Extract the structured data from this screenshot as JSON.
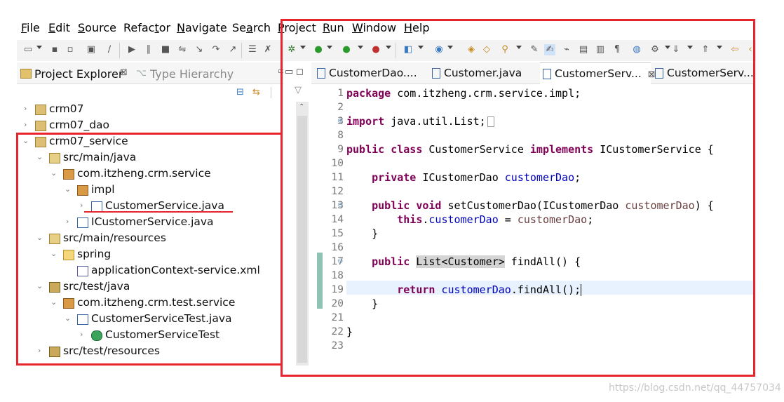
{
  "menu": [
    "File",
    "Edit",
    "Source",
    "Refactor",
    "Navigate",
    "Search",
    "Project",
    "Run",
    "Window",
    "Help"
  ],
  "menu_mnemonics": [
    "F",
    "E",
    "S",
    "t",
    "N",
    "a",
    "P",
    "R",
    "W",
    "H"
  ],
  "explorer": {
    "tab_active": "Project Explorer",
    "tab_inactive": "Type Hierarchy",
    "tree": [
      {
        "label": "crm07",
        "level": 0,
        "expanded": false,
        "icon": "project-icon"
      },
      {
        "label": "crm07_dao",
        "level": 0,
        "expanded": false,
        "icon": "project-icon"
      },
      {
        "label": "crm07_service",
        "level": 0,
        "expanded": true,
        "icon": "project-icon"
      },
      {
        "label": "src/main/java",
        "level": 1,
        "expanded": true,
        "icon": "source-folder-icon"
      },
      {
        "label": "com.itzheng.crm.service",
        "level": 2,
        "expanded": true,
        "icon": "package-icon"
      },
      {
        "label": "impl",
        "level": 3,
        "expanded": true,
        "icon": "package-icon"
      },
      {
        "label": "CustomerService.java",
        "level": 4,
        "expanded": false,
        "icon": "java-file-icon"
      },
      {
        "label": "ICustomerService.java",
        "level": 3,
        "expanded": false,
        "icon": "java-interface-icon"
      },
      {
        "label": "src/main/resources",
        "level": 1,
        "expanded": true,
        "icon": "source-folder-icon"
      },
      {
        "label": "spring",
        "level": 2,
        "expanded": true,
        "icon": "folder-icon"
      },
      {
        "label": "applicationContext-service.xml",
        "level": 3,
        "expanded": null,
        "icon": "xml-file-icon"
      },
      {
        "label": "src/test/java",
        "level": 1,
        "expanded": true,
        "icon": "source-folder-icon"
      },
      {
        "label": "com.itzheng.crm.test.service",
        "level": 2,
        "expanded": true,
        "icon": "package-icon"
      },
      {
        "label": "CustomerServiceTest.java",
        "level": 3,
        "expanded": true,
        "icon": "java-file-icon"
      },
      {
        "label": "CustomerServiceTest",
        "level": 4,
        "expanded": false,
        "icon": "class-icon"
      },
      {
        "label": "src/test/resources",
        "level": 1,
        "expanded": false,
        "icon": "source-folder-icon"
      }
    ]
  },
  "editor": {
    "tabs": [
      {
        "label": "CustomerDao....",
        "active": false
      },
      {
        "label": "Customer.java",
        "active": false
      },
      {
        "label": "CustomerServ...",
        "active": true
      },
      {
        "label": "CustomerServ...",
        "active": false
      }
    ],
    "line_numbers": [
      "1",
      "2",
      "3",
      "8",
      "9",
      "10",
      "11",
      "12",
      "13",
      "14",
      "15",
      "16",
      "17",
      "18",
      "19",
      "20",
      "21",
      "22",
      "23"
    ],
    "code": {
      "l1_kw": "package",
      "l1_rest": " com.itzheng.crm.service.impl;",
      "l3_kw": "import",
      "l3_rest": " java.util.List;",
      "l9_kw1": "public",
      "l9_kw2": "class",
      "l9_mid": " CustomerService ",
      "l9_kw3": "implements",
      "l9_rest": " ICustomerService {",
      "l11_kw": "private",
      "l11_type": " ICustomerDao ",
      "l11_fld": "customerDao",
      "l11_end": ";",
      "l13_kw1": "public",
      "l13_kw2": "void",
      "l13_mid": " setCustomerDao(ICustomerDao ",
      "l13_param": "customerDao",
      "l13_end": ") {",
      "l14_kw": "this",
      "l14_dot": ".",
      "l14_fld": "customerDao",
      "l14_eq": " = ",
      "l14_param": "customerDao",
      "l14_end": ";",
      "l15": "}",
      "l17_kw": "public",
      "l17_type": "List<Customer>",
      "l17_rest": " findAll() {",
      "l19_kw": "return",
      "l19_fld": "customerDao",
      "l19_rest": ".findAll();",
      "l20": "}",
      "l22": "}"
    }
  },
  "watermark": "https://blog.csdn.net/qq_44757034",
  "colors": {
    "highlight_red": "#e8242e",
    "keyword": "#7f0055",
    "field": "#0000c0"
  }
}
